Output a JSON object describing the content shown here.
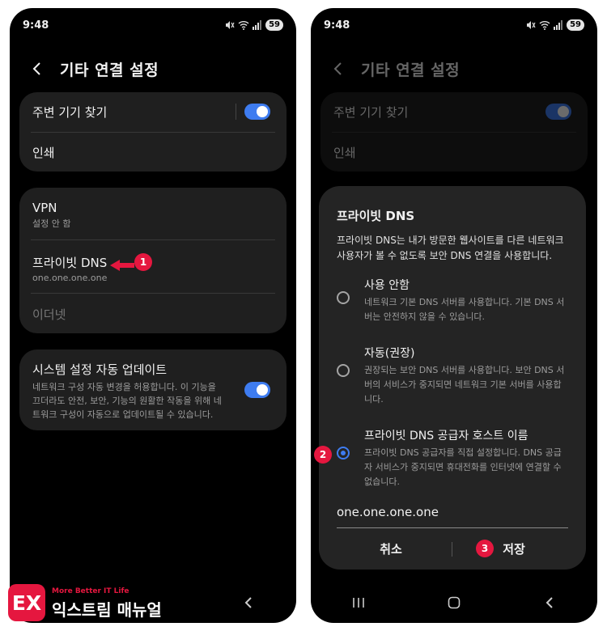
{
  "status": {
    "time": "9:48",
    "battery": "59"
  },
  "header": {
    "title": "기타 연결 설정"
  },
  "settings": {
    "nearby_devices": "주변 기기 찾기",
    "print": "인쇄",
    "vpn": {
      "label": "VPN",
      "sub": "설정 안 함"
    },
    "private_dns": {
      "label": "프라이빗 DNS",
      "sub": "one.one.one.one"
    },
    "ethernet": "이더넷",
    "auto_update": {
      "label": "시스템 설정 자동 업데이트",
      "sub": "네트워크 구성 자동 변경을 허용합니다. 이 기능을 끄더라도 안전, 보안, 기능의 원활한 작동을 위해 네트워크 구성이 자동으로 업데이트될 수 있습니다."
    }
  },
  "dialog": {
    "title": "프라이빗 DNS",
    "description": "프라이빗 DNS는 내가 방문한 웹사이트를 다른 네트워크 사용자가 볼 수 없도록 보안 DNS 연결을 사용합니다.",
    "options": [
      {
        "label": "사용 안함",
        "desc": "네트워크 기본 DNS 서버를 사용합니다. 기본 DNS 서버는 안전하지 않을 수 있습니다.",
        "selected": false
      },
      {
        "label": "자동(권장)",
        "desc": "권장되는 보안 DNS 서버를 사용합니다. 보안 DNS 서버의 서비스가 중지되면 네트워크 기본 서버를 사용합니다.",
        "selected": false
      },
      {
        "label": "프라이빗 DNS 공급자 호스트 이름",
        "desc": "프라이빗 DNS 공급자를 직접 설정합니다. DNS 공급자 서비스가 중지되면 휴대전화를 인터넷에 연결할 수 없습니다.",
        "selected": true
      }
    ],
    "hostname": "one.one.one.one",
    "cancel": "취소",
    "save": "저장"
  },
  "badges": {
    "b1": "1",
    "b2": "2",
    "b3": "3"
  },
  "watermark": {
    "logo": "EX",
    "tagline": "More Better IT Life",
    "name": "익스트림 매뉴얼"
  },
  "colors": {
    "accent": "#3e7cf0",
    "badge": "#e5173f",
    "card": "#1f1f1f",
    "background": "#000000"
  }
}
